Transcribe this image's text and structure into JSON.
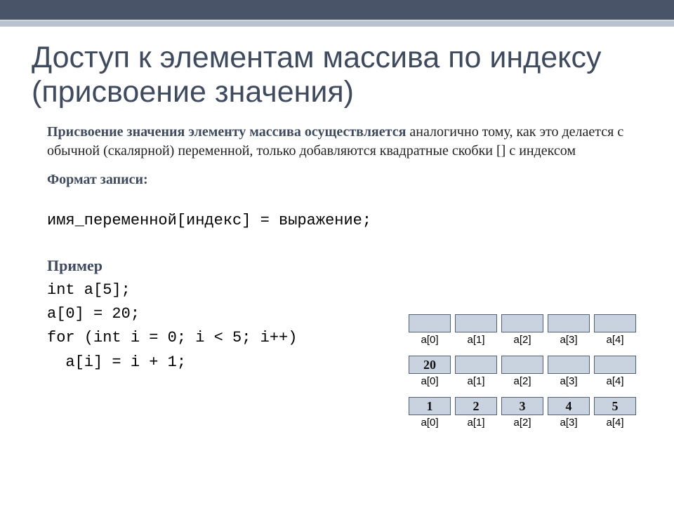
{
  "title": "Доступ к элементам массива по индексу (присвоение значения)",
  "lead": "Присвоение значения элементу массива осуществляется",
  "lead_rest": " аналогично тому, как это делается с обычной (скалярной) переменной, только добавляются квадратные скобки [] с индексом",
  "format_label": "Формат записи:",
  "format_code": "имя_переменной[индекс] = выражение;",
  "example_label": "Пример",
  "code_lines": {
    "l1": "int a[5];",
    "l2": "a[0] = 20;",
    "l3": "for (int i = 0; i < 5; i++)",
    "l4": "  a[i] = i + 1;"
  },
  "arrays": {
    "labels": [
      "a[0]",
      "a[1]",
      "a[2]",
      "a[3]",
      "a[4]"
    ],
    "row1": [
      "",
      "",
      "",
      "",
      ""
    ],
    "row2": [
      "20",
      "",
      "",
      "",
      ""
    ],
    "row3": [
      "1",
      "2",
      "3",
      "4",
      "5"
    ]
  }
}
